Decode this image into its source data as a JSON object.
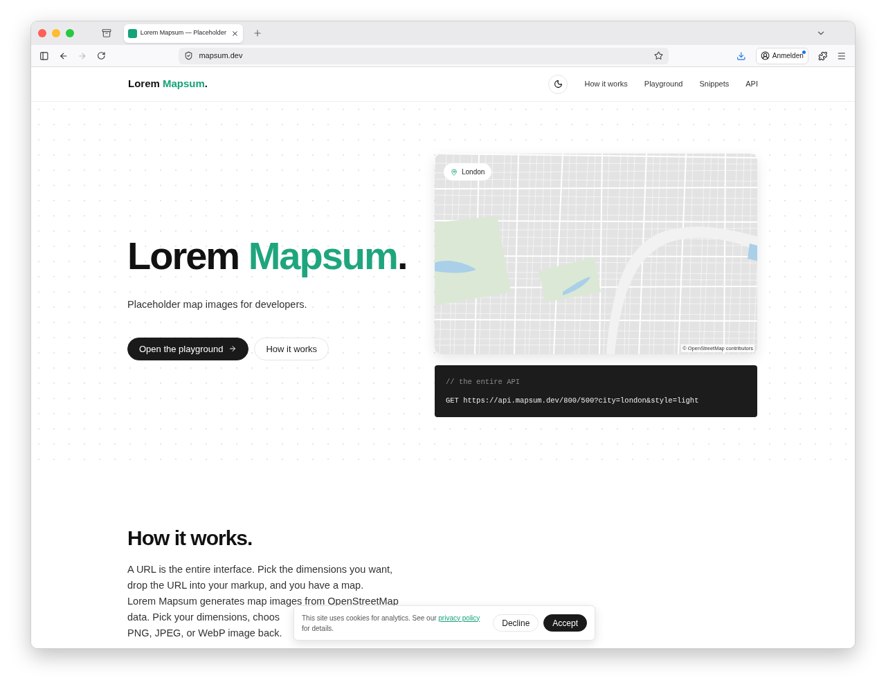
{
  "browser": {
    "tab_title": "Lorem Mapsum — Placeholder",
    "address": "mapsum.dev",
    "account_button": "Anmelden"
  },
  "nav": {
    "logo": {
      "text": "Lorem",
      "accent": "Mapsum",
      "dot": "."
    },
    "links": [
      "How it works",
      "Playground",
      "Snippets",
      "API"
    ]
  },
  "hero": {
    "title": {
      "text": "Lorem",
      "accent": "Mapsum",
      "dot": "."
    },
    "subtitle": "Placeholder map images for developers.",
    "buttons": [
      {
        "label": "Open the playground",
        "kind": "primary"
      },
      {
        "label": "How it works",
        "kind": "secondary"
      }
    ]
  },
  "map": {
    "location": "London",
    "attribution": "© OpenStreetMap contributors"
  },
  "code": {
    "comment": "// the entire API",
    "request": "GET https://api.mapsum.dev/800/500?city=london&style=light"
  },
  "how": {
    "heading": "How it works.",
    "intro": "A URL is the entire interface. Pick the dimensions you want, drop the URL into your markup, and you have a map.",
    "body": {
      "before": "Lorem Mapsum generates map images from ",
      "link": "OpenStreetMap",
      "line_end": " data. Pick your dimensions, choos",
      "last_line": "PNG, JPEG, or WebP image back."
    }
  },
  "cookie": {
    "before": "This site uses cookies for analytics. See our ",
    "link": "privacy policy",
    "after": " for details.",
    "buttons": [
      {
        "label": "Decline",
        "kind": "secondary"
      },
      {
        "label": "Accept",
        "kind": "primary"
      }
    ]
  }
}
